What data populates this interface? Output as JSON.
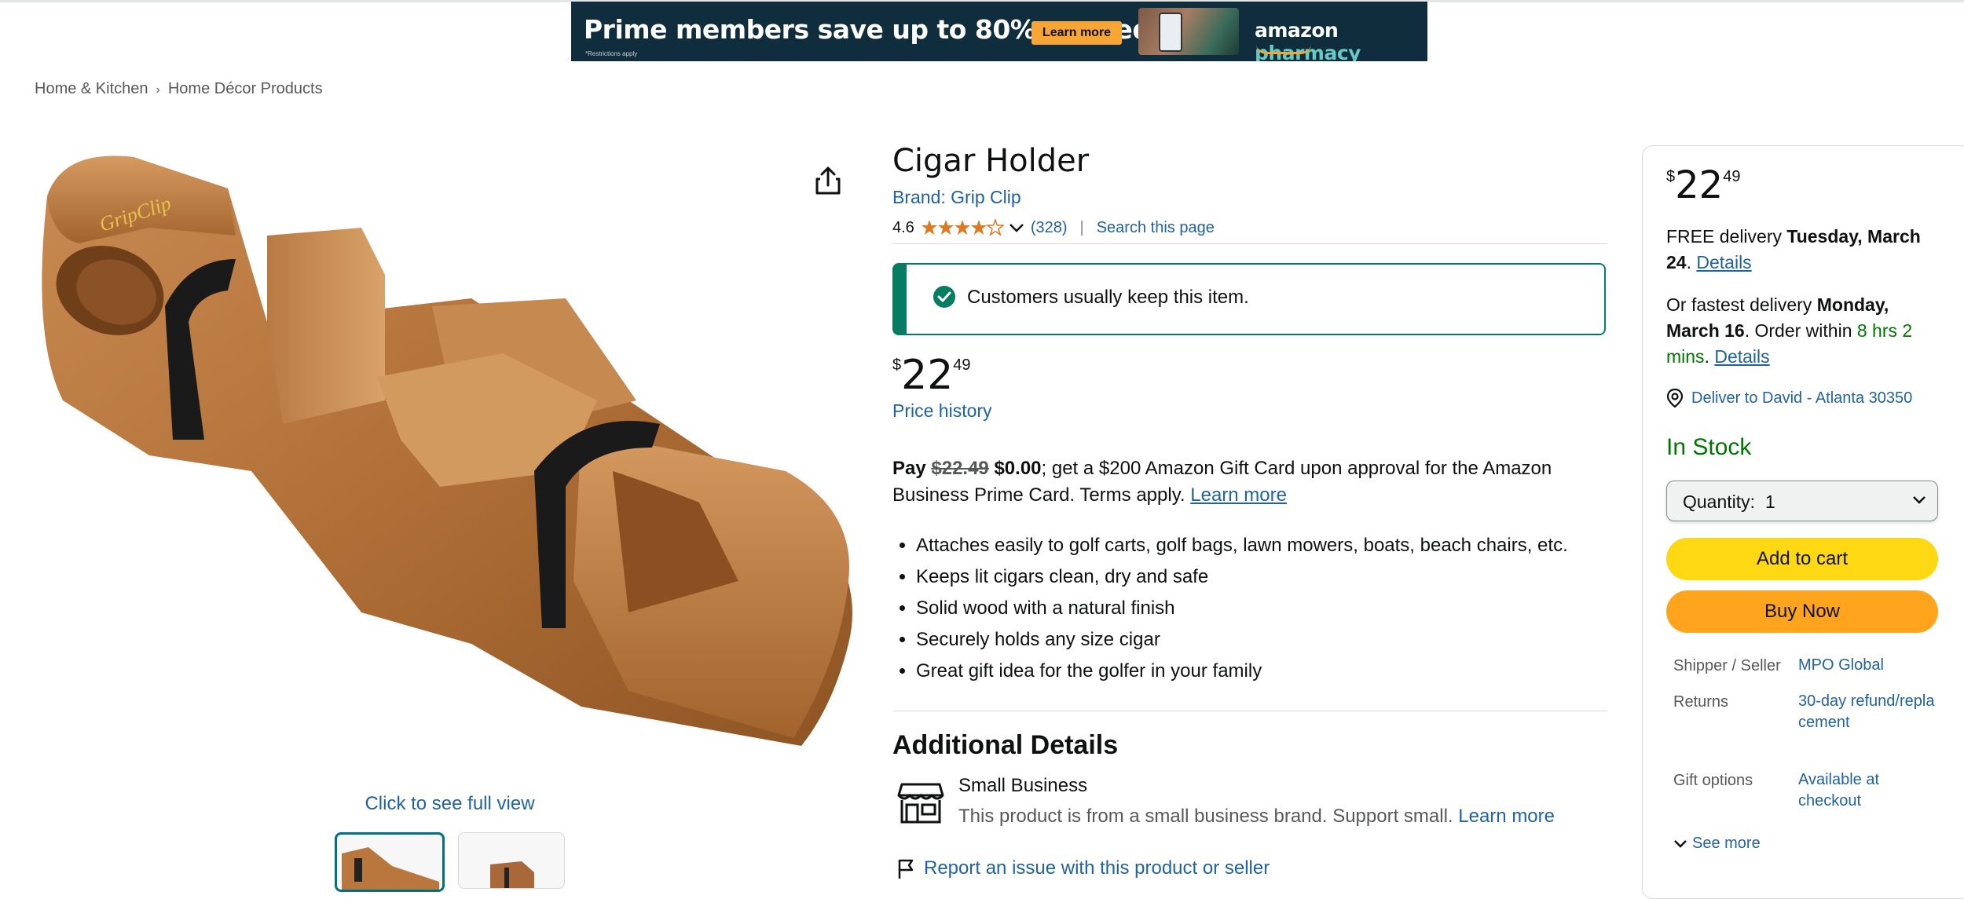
{
  "banner": {
    "headline": "Prime members save up to 80% on meds",
    "note": "*Restrictions apply",
    "button": "Learn more",
    "brand_main": "amazon",
    "brand_sub": "pharmacy"
  },
  "breadcrumb": [
    "Home & Kitchen",
    "Home Décor Products"
  ],
  "gallery": {
    "full_view": "Click to see full view"
  },
  "product": {
    "title": "Cigar Holder",
    "brand": "Brand: Grip Clip",
    "rating": "4.6",
    "stars_value": 4.6,
    "stars_max": 5,
    "review_count": "(328)",
    "search_page": "Search this page",
    "keep_message": "Customers usually keep this item.",
    "price_symbol": "$",
    "price_whole": "22",
    "price_fraction": "49",
    "price_history": "Price history",
    "promo": {
      "pay": "Pay",
      "old_price": "$22.49",
      "new_price": "$0.00",
      "text": "; get a $200 Amazon Gift Card upon approval for the Amazon Business Prime Card. Terms apply.",
      "learn_more": "Learn more"
    },
    "bullets": [
      "Attaches easily to golf carts, golf bags, lawn mowers, boats, beach chairs, etc.",
      "Keeps lit cigars clean, dry and safe",
      "Solid wood with a natural finish",
      "Securely holds any size cigar",
      "Great gift idea for the golfer in your family"
    ],
    "additional_title": "Additional Details",
    "small_business_title": "Small Business",
    "small_business_desc": "This product is from a small business brand. Support small.",
    "small_business_learn": "Learn more",
    "report": "Report an issue with this product or seller"
  },
  "buybox": {
    "price_symbol": "$",
    "price_whole": "22",
    "price_fraction": "49",
    "delivery_prefix": "FREE delivery",
    "delivery_date": "Tuesday, March 24",
    "details": "Details",
    "fastest_prefix": "Or fastest delivery",
    "fastest_date": "Monday, March 16",
    "order_within": ". Order within",
    "countdown": "8 hrs 2 mins",
    "deliver_to": "Deliver to David - Atlanta 30350",
    "stock": "In Stock",
    "quantity_label": "Quantity:",
    "quantity_value": "1",
    "add_to_cart": "Add to cart",
    "buy_now": "Buy Now",
    "info": [
      {
        "label": "Shipper / Seller",
        "value": "MPO Global"
      },
      {
        "label": "Returns",
        "value": "30-day refund/replacement"
      },
      {
        "label": "Gift options",
        "value": "Available at checkout"
      }
    ],
    "see_more": "See more"
  },
  "colors": {
    "link": "#2162a1",
    "success": "#067d62",
    "stock": "#007600",
    "cart": "#ffd814",
    "buy": "#ffa41c",
    "star": "#de7921"
  }
}
